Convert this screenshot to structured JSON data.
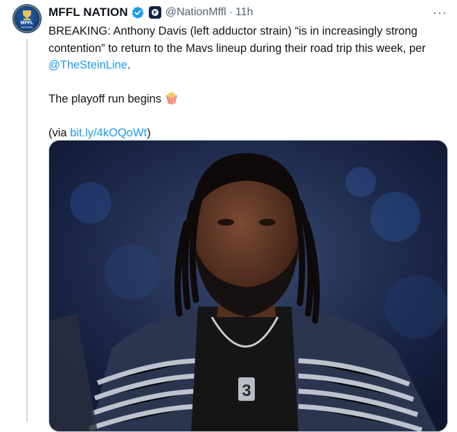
{
  "tweet": {
    "author_name": "MFFL NATION",
    "handle": "@NationMffl",
    "separator": "·",
    "time": "11h",
    "more_label": "···",
    "avatar_text_top": "MFFL",
    "avatar_text_bottom": "NATION",
    "line1_pre": "BREAKING: Anthony Davis (left adductor strain) “is in increasingly strong contention” to return to the Mavs lineup during their road trip this week, per ",
    "mention": "@TheSteinLine",
    "line1_post": ".",
    "line2": "The playoff run begins ",
    "line2_emoji": "🍿",
    "line3_pre": "(via ",
    "link": "bit.ly/4kOQoWt",
    "line3_post": ")"
  },
  "media": {
    "description_jersey_number": "3"
  },
  "colors": {
    "accent": "#1d9bf0",
    "text": "#0f1419",
    "muted": "#536471"
  }
}
